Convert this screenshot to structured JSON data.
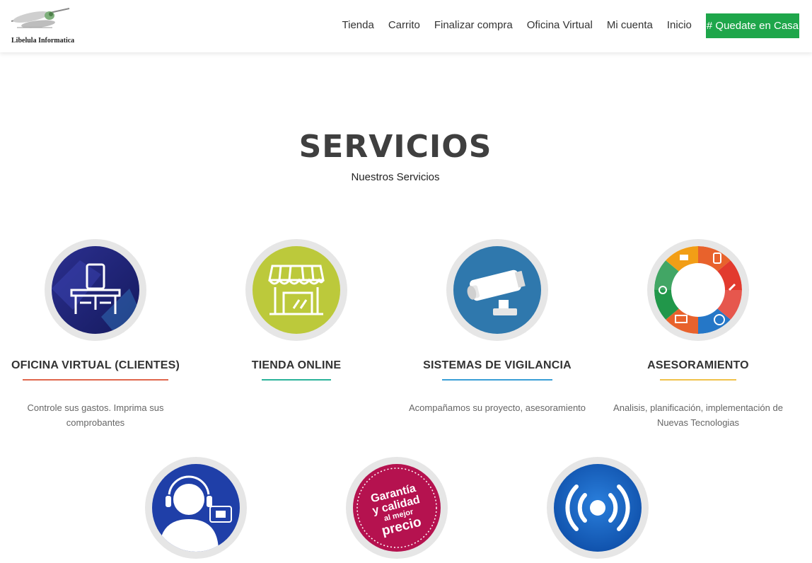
{
  "header": {
    "logo_text": "Libelula Informatica",
    "nav": [
      "Tienda",
      "Carrito",
      "Finalizar compra",
      "Oficina Virtual",
      "Mi cuenta",
      "Inicio"
    ],
    "cta_label": "# Quedate en Casa",
    "cta_color": "#1ea64a"
  },
  "section": {
    "title": "SERVICIOS",
    "subtitle": "Nuestros Servicios"
  },
  "services": [
    {
      "title": "OFICINA VIRTUAL (CLIENTES)",
      "desc": "Controle sus gastos. Imprima sus comprobantes",
      "accent": "#e0664d",
      "icon": "desk-chair-icon"
    },
    {
      "title": "TIENDA ONLINE",
      "desc": "",
      "accent": "#2bb39a",
      "icon": "storefront-icon"
    },
    {
      "title": "SISTEMAS DE VIGILANCIA",
      "desc": "Acompañamos su proyecto, asesoramiento",
      "accent": "#3a9fd6",
      "icon": "security-camera-icon"
    },
    {
      "title": "ASESORAMIENTO",
      "desc": "Analisis, planificación, implementación de Nuevas Tecnologias",
      "accent": "#f0c24b",
      "icon": "tech-ring-icon"
    }
  ],
  "services_row2": [
    {
      "icon": "support-headset-icon"
    },
    {
      "icon": "guarantee-badge-icon",
      "badge_lines": [
        "Garantía",
        "y calidad",
        "al mejor",
        "precio"
      ]
    },
    {
      "icon": "wireless-signal-icon"
    }
  ]
}
